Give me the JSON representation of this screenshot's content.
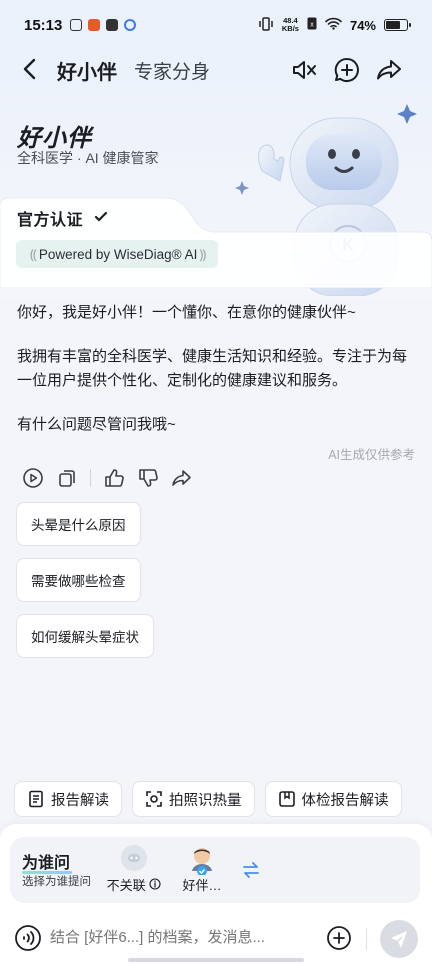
{
  "status": {
    "time": "15:13",
    "net_speed_value": "48.4",
    "net_speed_unit": "KB/s",
    "battery": "74%",
    "battery_level": 0.74
  },
  "nav": {
    "title": "好小伴",
    "subtitle": "专家分身"
  },
  "hero": {
    "name": "好小伴",
    "desc": "全科医学 · AI 健康管家",
    "cert_title": "官方认证",
    "powered": "Powered by WiseDiag® AI"
  },
  "messages": [
    "你好，我是好小伴！一个懂你、在意你的健康伙伴~",
    "我拥有丰富的全科医学、健康生活知识和经验。专注于为每一位用户提供个性化、定制化的健康建议和服务。",
    "有什么问题尽管问我哦~"
  ],
  "ai_note": "AI生成仅供参考",
  "suggestions": [
    "头晕是什么原因",
    "需要做哪些检查",
    "如何缓解头晕症状"
  ],
  "tools": [
    {
      "label": "报告解读",
      "icon": "report-icon"
    },
    {
      "label": "拍照识热量",
      "icon": "scan-icon"
    },
    {
      "label": "体检报告解读",
      "icon": "checkup-icon"
    }
  ],
  "ask": {
    "title": "为谁问",
    "subtitle": "选择为谁提问",
    "option_none": "不关联",
    "option_member": "好伴…"
  },
  "input": {
    "placeholder": "结合 [好伴6...] 的档案，发消息..."
  },
  "colors": {
    "accent": "#2bb5a0",
    "link_blue": "#4a8df0"
  }
}
